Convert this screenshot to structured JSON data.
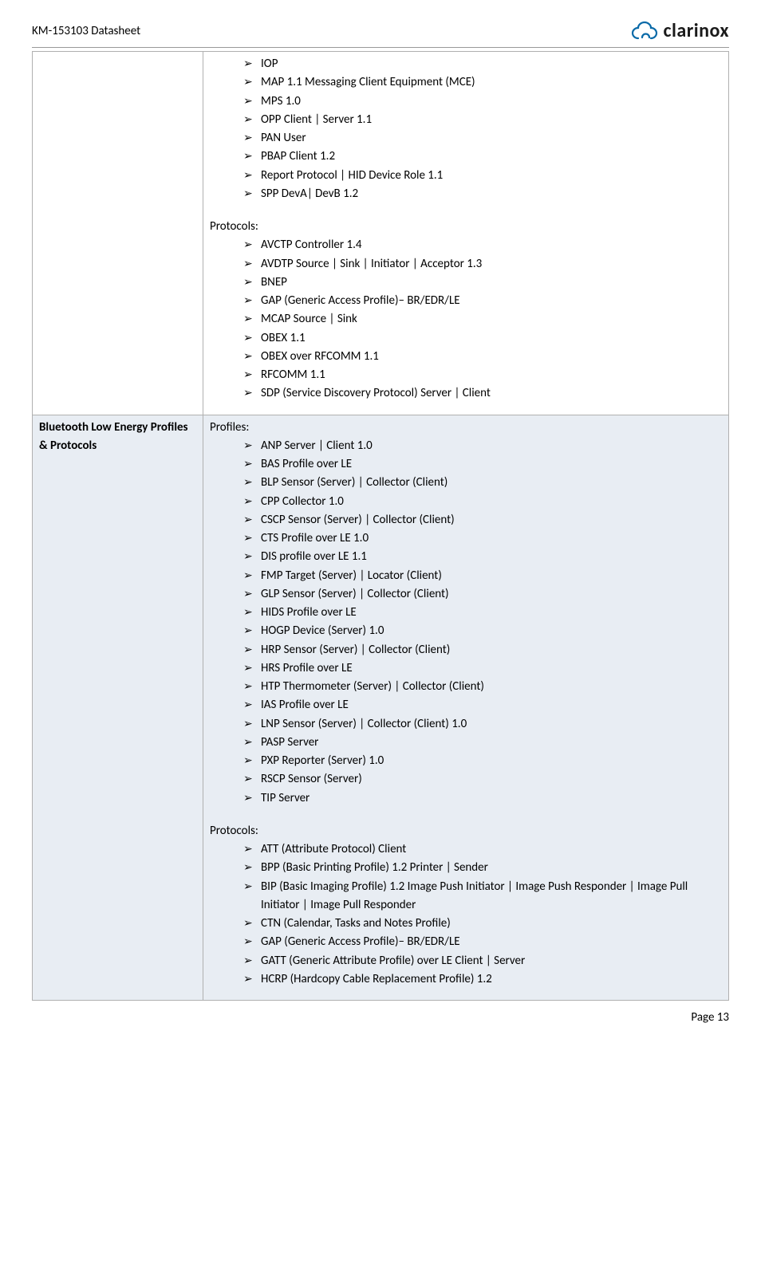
{
  "header": {
    "title": "KM-153103 Datasheet",
    "brand": "clarinox"
  },
  "row1": {
    "label": "",
    "list1": [
      "IOP",
      "MAP 1.1 Messaging Client Equipment (MCE)",
      "MPS 1.0",
      "OPP Client | Server 1.1",
      "PAN User",
      "PBAP Client 1.2",
      "Report Protocol | HID Device Role 1.1",
      "SPP DevA| DevB 1.2"
    ],
    "heading2": "Protocols:",
    "list2": [
      "AVCTP Controller 1.4",
      "AVDTP Source | Sink | Initiator | Acceptor 1.3",
      "BNEP",
      "GAP (Generic Access Profile)– BR/EDR/LE",
      "MCAP Source | Sink",
      "OBEX 1.1",
      "OBEX over RFCOMM 1.1",
      "RFCOMM 1.1",
      "SDP (Service Discovery Protocol) Server | Client"
    ]
  },
  "row2": {
    "label": "Bluetooth Low Energy Profiles & Protocols",
    "heading1": "Profiles:",
    "list1": [
      "ANP Server | Client 1.0",
      "BAS Profile over LE",
      "BLP Sensor (Server) | Collector (Client)",
      "CPP Collector 1.0",
      "CSCP Sensor (Server) | Collector (Client)",
      "CTS Profile over LE 1.0",
      "DIS profile over LE 1.1",
      "FMP Target (Server) | Locator (Client)",
      "GLP Sensor (Server) | Collector (Client)",
      "HIDS Profile over LE",
      "HOGP Device (Server) 1.0",
      "HRP Sensor (Server) | Collector (Client)",
      "HRS Profile over LE",
      "HTP Thermometer (Server) | Collector (Client)",
      "IAS Profile over LE",
      "LNP Sensor (Server) | Collector (Client) 1.0",
      "PASP Server",
      "PXP Reporter (Server) 1.0",
      "RSCP Sensor (Server)",
      "TIP Server"
    ],
    "heading2": "Protocols:",
    "list2": [
      "ATT (Attribute Protocol) Client",
      "BPP (Basic Printing Profile) 1.2 Printer | Sender",
      "BIP (Basic Imaging Profile) 1.2 Image Push Initiator | Image Push Responder | Image Pull Initiator | Image Pull Responder",
      "CTN (Calendar, Tasks and Notes Profile)",
      "GAP (Generic Access Profile)– BR/EDR/LE",
      "GATT (Generic Attribute Profile) over LE Client | Server",
      "HCRP (Hardcopy Cable Replacement Profile) 1.2"
    ]
  },
  "footer": {
    "page": "Page 13"
  }
}
